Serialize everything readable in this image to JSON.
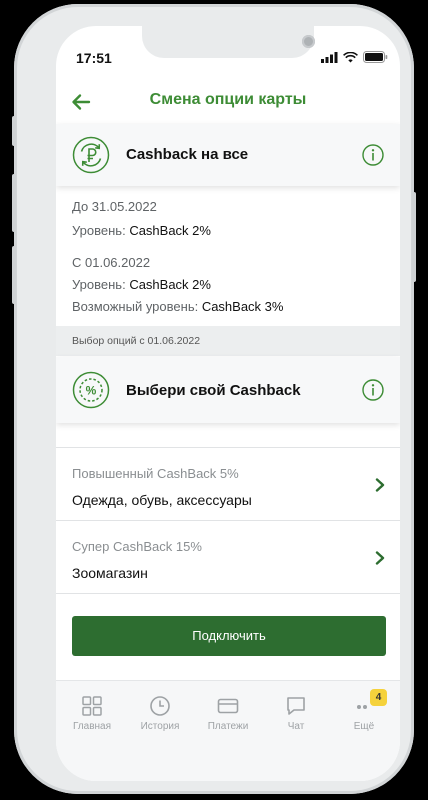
{
  "status_bar": {
    "time": "17:51"
  },
  "header": {
    "title": "Смена опции карты"
  },
  "current_option": {
    "label": "Cashback на все"
  },
  "periods": {
    "p1_date": "До 31.05.2022",
    "p1_level_prefix": "Уровень: ",
    "p1_level_value": "CashBack 2%",
    "p2_date": "С 01.06.2022",
    "p2_level_prefix": "Уровень: ",
    "p2_level_value": "CashBack 2%",
    "p2_possible_prefix": "Возможный уровень: ",
    "p2_possible_value": "CashBack 3%"
  },
  "section": {
    "label": "Выбор опций с 01.06.2022"
  },
  "choose_card": {
    "label": "Выбери свой Cashback"
  },
  "options": [
    {
      "subtitle": "Повышенный CashBack 5%",
      "title": "Одежда, обувь, аксессуары"
    },
    {
      "subtitle": "Супер CashBack 15%",
      "title": "Зоомагазин"
    }
  ],
  "cta": {
    "label": "Подключить"
  },
  "tabbar": {
    "tabs": [
      {
        "label": "Главная"
      },
      {
        "label": "История"
      },
      {
        "label": "Платежи"
      },
      {
        "label": "Чат"
      },
      {
        "label": "Ещё"
      }
    ],
    "more_badge": "4"
  },
  "colors": {
    "accent": "#3d8c35",
    "button": "#2d6d30",
    "badge": "#f5d23c"
  }
}
